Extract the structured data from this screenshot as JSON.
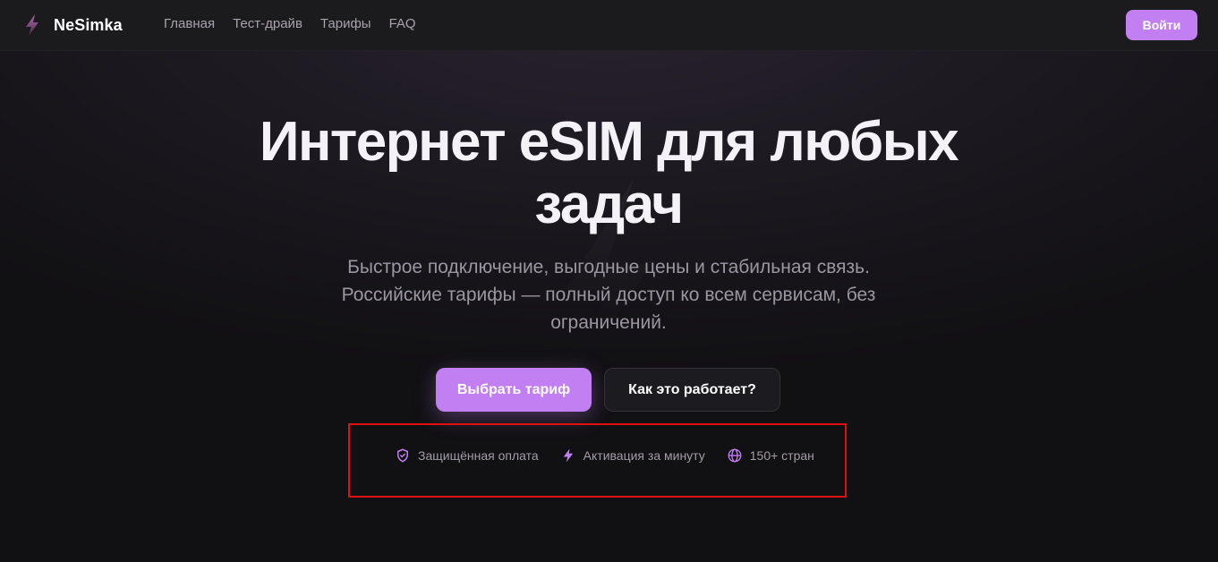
{
  "brand": {
    "name": "NeSimka",
    "icon": "lightning-bolt-icon"
  },
  "nav": {
    "items": [
      {
        "label": "Главная"
      },
      {
        "label": "Тест-драйв"
      },
      {
        "label": "Тарифы"
      },
      {
        "label": "FAQ"
      }
    ]
  },
  "header": {
    "login_label": "Войти"
  },
  "hero": {
    "title_line1": "Интернет eSIM для любых",
    "title_line2": "задач",
    "subtitle_line1": "Быстрое подключение, выгодные цены и стабильная связь.",
    "subtitle_line2": "Российские тарифы — полный доступ ко всем сервисам, без",
    "subtitle_line3": "ограничений.",
    "primary_button": "Выбрать тариф",
    "secondary_button": "Как это работает?"
  },
  "features": [
    {
      "icon": "shield-check-icon",
      "label": "Защищённая оплата"
    },
    {
      "icon": "lightning-icon",
      "label": "Активация за минуту"
    },
    {
      "icon": "globe-icon",
      "label": "150+ стран"
    }
  ],
  "colors": {
    "accent": "#c17ff2",
    "background": "#111013",
    "header_bg": "#1b1a1d",
    "highlight_box": "#e01010"
  }
}
